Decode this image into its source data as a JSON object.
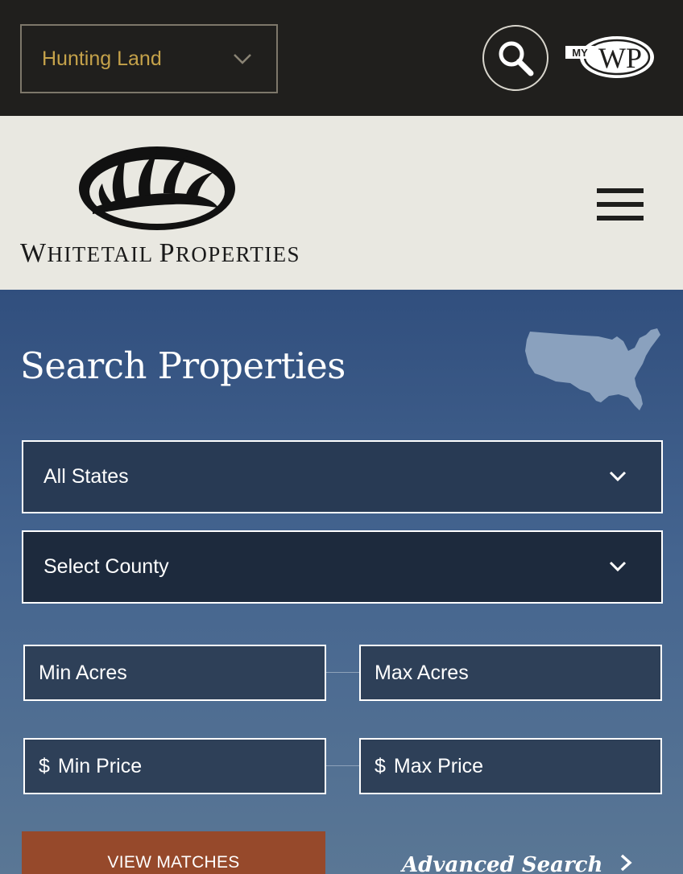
{
  "topbar": {
    "category_value": "Hunting Land",
    "search_icon": "magnifier-icon",
    "account_logo": {
      "small": "MY",
      "large": "WP"
    }
  },
  "header": {
    "brand_name": "Whitetail Properties",
    "brand_parts": {
      "w": "W",
      "hitetail": "HITETAIL",
      "p": "P",
      "roperties": "ROPERTIES"
    },
    "menu_icon": "hamburger-icon"
  },
  "search": {
    "title": "Search Properties",
    "map_icon": "usa-map-icon",
    "state_select": "All States",
    "county_select": "Select County",
    "min_acres_placeholder": "Min Acres",
    "max_acres_placeholder": "Max Acres",
    "currency_symbol": "$",
    "min_price_placeholder": "Min Price",
    "max_price_placeholder": "Max Price",
    "view_matches_label": "VIEW MATCHES",
    "advanced_search_label": "Advanced Search"
  },
  "colors": {
    "topbar_bg": "#201f1d",
    "accent_gold": "#c5a24a",
    "header_bg": "#e9e8e1",
    "panel_top": "#314f7e",
    "panel_bottom": "#5a7795",
    "button_rust": "#96492b"
  }
}
